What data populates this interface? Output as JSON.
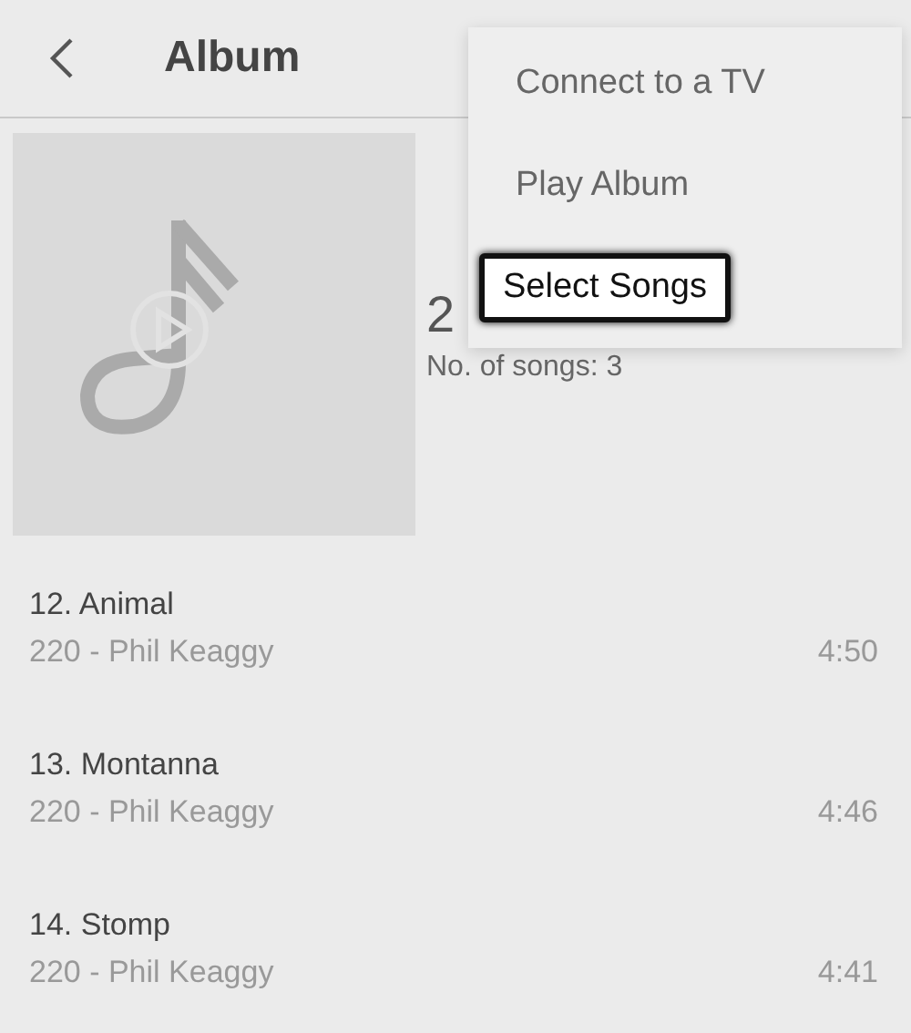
{
  "header": {
    "title": "Album"
  },
  "album": {
    "title": "2",
    "song_count": "No. of songs: 3"
  },
  "songs": [
    {
      "title": "12. Animal",
      "subtitle": "220 - Phil Keaggy",
      "duration": "4:50"
    },
    {
      "title": "13. Montanna",
      "subtitle": "220 - Phil Keaggy",
      "duration": "4:46"
    },
    {
      "title": "14. Stomp",
      "subtitle": "220 - Phil Keaggy",
      "duration": "4:41"
    }
  ],
  "menu": [
    {
      "label": "Connect to a TV",
      "selected": false
    },
    {
      "label": "Play Album",
      "selected": false
    },
    {
      "label": "Select Songs",
      "selected": true
    }
  ]
}
